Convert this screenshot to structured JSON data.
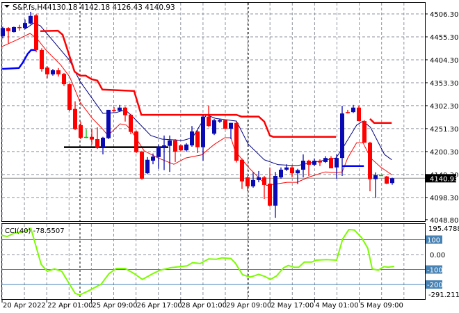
{
  "header": {
    "symbol": "S&P.fs,H4",
    "ohlc": "4130.18 4142.18 4126.43 4140.93"
  },
  "colors": {
    "bull": "#0a0ab4",
    "bear": "#ff0000",
    "ma_slow": "#000080",
    "ma_fast": "#ff0000",
    "stop_line": "#ff0000",
    "blue_line": "#0000ff",
    "cci": "#7cfc00",
    "level": "#4682b4",
    "grid": "#8c929c"
  },
  "price_axis": [
    "4506.30",
    "4455.30",
    "4404.30",
    "4353.30",
    "4302.30",
    "4251.30",
    "4200.30",
    "4149.30",
    "4098.30",
    "4048.80"
  ],
  "current_price": "4140.93",
  "time_axis": [
    "20 Apr 2022",
    "22 Apr 01:00",
    "25 Apr 09:00",
    "26 Apr 17:00",
    "28 Apr 01:00",
    "29 Apr 09:00",
    "2 May 17:00",
    "4 May 01:00",
    "5 May 09:00"
  ],
  "cci": {
    "label": "CCI(40) -78.5507",
    "max_label": "195.4788",
    "min_label": "-291.2113",
    "zero_label": "0.00",
    "levels": [
      "100",
      "-100",
      "-200"
    ]
  },
  "chart_data": {
    "type": "candlestick",
    "title": "S&P.fs,H4",
    "ylim": [
      4048.8,
      4506.3
    ],
    "candles": [
      [
        4457,
        4478,
        4452,
        4475
      ],
      [
        4475,
        4477,
        4441,
        4468
      ],
      [
        4466,
        4478,
        4465,
        4477
      ],
      [
        4477,
        4482,
        4469,
        4475
      ],
      [
        4475,
        4494,
        4472,
        4486
      ],
      [
        4485,
        4511,
        4483,
        4502
      ],
      [
        4503,
        4506,
        4421,
        4426
      ],
      [
        4426,
        4430,
        4378,
        4384
      ],
      [
        4387,
        4390,
        4363,
        4372
      ],
      [
        4372,
        4384,
        4369,
        4381
      ],
      [
        4381,
        4386,
        4367,
        4372
      ],
      [
        4373,
        4375,
        4346,
        4350
      ],
      [
        4350,
        4352,
        4290,
        4293
      ],
      [
        4295,
        4312,
        4248,
        4250
      ],
      [
        4259,
        4267,
        4228,
        4231
      ],
      [
        4233,
        4250,
        4230,
        4233
      ],
      [
        4233,
        4251,
        4216,
        4227
      ],
      [
        4228,
        4254,
        4206,
        4208
      ],
      [
        4210,
        4233,
        4194,
        4231
      ],
      [
        4230,
        4293,
        4228,
        4293
      ],
      [
        4293,
        4299,
        4289,
        4291
      ],
      [
        4291,
        4304,
        4289,
        4298
      ],
      [
        4298,
        4300,
        4267,
        4281
      ],
      [
        4282,
        4284,
        4239,
        4244
      ],
      [
        4245,
        4247,
        4197,
        4199
      ],
      [
        4200,
        4202,
        4138,
        4140
      ],
      [
        4152,
        4188,
        4150,
        4182
      ],
      [
        4180,
        4196,
        4172,
        4189
      ],
      [
        4188,
        4216,
        4162,
        4211
      ],
      [
        4210,
        4236,
        4159,
        4214
      ],
      [
        4213,
        4236,
        4155,
        4225
      ],
      [
        4225,
        4228,
        4177,
        4200
      ],
      [
        4214,
        4216,
        4200,
        4203
      ],
      [
        4203,
        4219,
        4200,
        4216
      ],
      [
        4214,
        4257,
        4211,
        4245
      ],
      [
        4245,
        4248,
        4197,
        4210
      ],
      [
        4210,
        4281,
        4180,
        4278
      ],
      [
        4278,
        4302,
        4255,
        4257
      ],
      [
        4240,
        4273,
        4237,
        4270
      ],
      [
        4267,
        4272,
        4264,
        4270
      ],
      [
        4270,
        4272,
        4250,
        4251
      ],
      [
        4251,
        4264,
        4228,
        4264
      ],
      [
        4264,
        4266,
        4176,
        4180
      ],
      [
        4182,
        4185,
        4117,
        4134
      ],
      [
        4143,
        4146,
        4112,
        4123
      ],
      [
        4123,
        4154,
        4120,
        4137
      ],
      [
        4137,
        4157,
        4132,
        4143
      ],
      [
        4143,
        4146,
        4095,
        4126
      ],
      [
        4129,
        4165,
        4078,
        4080
      ],
      [
        4080,
        4155,
        4053,
        4146
      ],
      [
        4143,
        4165,
        4140,
        4160
      ],
      [
        4160,
        4172,
        4157,
        4165
      ],
      [
        4165,
        4168,
        4143,
        4152
      ],
      [
        4152,
        4162,
        4128,
        4159
      ],
      [
        4160,
        4194,
        4143,
        4180
      ],
      [
        4180,
        4182,
        4146,
        4171
      ],
      [
        4171,
        4185,
        4168,
        4180
      ],
      [
        4180,
        4183,
        4168,
        4176
      ],
      [
        4177,
        4190,
        4175,
        4186
      ],
      [
        4186,
        4190,
        4163,
        4163
      ],
      [
        4165,
        4194,
        4140,
        4186
      ],
      [
        4186,
        4302,
        4146,
        4285
      ],
      [
        4288,
        4293,
        4285,
        4286
      ],
      [
        4288,
        4304,
        4286,
        4298
      ],
      [
        4298,
        4302,
        4268,
        4268
      ],
      [
        4268,
        4270,
        4220,
        4220
      ],
      [
        4220,
        4222,
        4112,
        4139
      ],
      [
        4139,
        4154,
        4097,
        4148
      ],
      [
        4148,
        4149,
        4147,
        4148
      ],
      [
        4145,
        4146,
        4128,
        4129
      ],
      [
        4130.18,
        4142.18,
        4126.43,
        4140.93
      ]
    ],
    "ma_slow": [
      [
        3.9,
        4472
      ],
      [
        5.6,
        4486
      ],
      [
        6.75,
        4480
      ],
      [
        12,
        4403
      ],
      [
        13.9,
        4356
      ],
      [
        18,
        4285
      ],
      [
        20.4,
        4287
      ],
      [
        22,
        4293
      ],
      [
        23.25,
        4279
      ],
      [
        26.6,
        4236
      ],
      [
        28.6,
        4228
      ],
      [
        32.4,
        4225
      ],
      [
        34.1,
        4231
      ],
      [
        36.6,
        4282
      ],
      [
        38.25,
        4274
      ],
      [
        42,
        4268
      ],
      [
        44.1,
        4217
      ],
      [
        47,
        4182
      ],
      [
        49.5,
        4171
      ],
      [
        52.9,
        4169
      ],
      [
        54.9,
        4174
      ],
      [
        59.9,
        4186
      ],
      [
        61.1,
        4208
      ],
      [
        63.6,
        4259
      ],
      [
        64.75,
        4268
      ],
      [
        66.1,
        4254
      ],
      [
        68.6,
        4194
      ],
      [
        69.9,
        4182
      ]
    ],
    "ma_fast": [
      [
        -0.1,
        4434
      ],
      [
        2.6,
        4449
      ],
      [
        4.9,
        4463
      ],
      [
        6.1,
        4452
      ],
      [
        7.9,
        4424
      ],
      [
        10.4,
        4393
      ],
      [
        12,
        4367
      ],
      [
        13.9,
        4310
      ],
      [
        16.1,
        4274
      ],
      [
        17.9,
        4251
      ],
      [
        18.9,
        4236
      ],
      [
        21.1,
        4262
      ],
      [
        22.25,
        4259
      ],
      [
        23.25,
        4244
      ],
      [
        25.4,
        4202
      ],
      [
        27.9,
        4186
      ],
      [
        30.75,
        4172
      ],
      [
        32.9,
        4186
      ],
      [
        35.75,
        4193
      ],
      [
        38,
        4216
      ],
      [
        39.9,
        4231
      ],
      [
        41,
        4231
      ],
      [
        41.75,
        4202
      ],
      [
        44.1,
        4166
      ],
      [
        47.4,
        4125
      ],
      [
        51.1,
        4132
      ],
      [
        52.9,
        4132
      ],
      [
        54.9,
        4143
      ],
      [
        57.9,
        4155
      ],
      [
        59.9,
        4154
      ],
      [
        61,
        4155
      ],
      [
        62,
        4186
      ],
      [
        63.6,
        4220
      ],
      [
        64.75,
        4220
      ],
      [
        66.1,
        4186
      ],
      [
        67.9,
        4166
      ],
      [
        69.9,
        4149
      ]
    ],
    "stop_line": [
      [
        [
          6.75,
          4468
        ],
        [
          9.9,
          4469
        ],
        [
          10.75,
          4460
        ],
        [
          12.9,
          4378
        ],
        [
          13.9,
          4369
        ],
        [
          14.9,
          4369
        ],
        [
          16,
          4361
        ],
        [
          17,
          4358
        ],
        [
          17.9,
          4338
        ],
        [
          23.6,
          4335
        ],
        [
          24.9,
          4282
        ],
        [
          42,
          4282
        ],
        [
          42.9,
          4278
        ],
        [
          46,
          4278
        ],
        [
          47,
          4267
        ],
        [
          48,
          4236
        ],
        [
          48.6,
          4233
        ],
        [
          59.9,
          4233
        ]
      ],
      [
        [
          66,
          4273
        ],
        [
          66.75,
          4264
        ],
        [
          69.9,
          4264
        ]
      ]
    ],
    "blue_line": [
      [
        [
          -0.1,
          4384
        ],
        [
          2.9,
          4386
        ],
        [
          3.6,
          4398
        ],
        [
          4.5,
          4418
        ],
        [
          5.1,
          4426
        ],
        [
          6,
          4426
        ]
      ],
      [
        [
          61,
          4168
        ],
        [
          64.9,
          4168
        ]
      ]
    ],
    "support_line": {
      "from": 11,
      "to": 29.75,
      "price": 4210
    },
    "cci_series": [
      [
        -0.24,
        129
      ],
      [
        0.8,
        121
      ],
      [
        2.1,
        144
      ],
      [
        3.7,
        152
      ],
      [
        5.05,
        175
      ],
      [
        6.9,
        -65
      ],
      [
        8,
        -112
      ],
      [
        9.3,
        -96
      ],
      [
        10.6,
        -112
      ],
      [
        13,
        -259
      ],
      [
        13.8,
        -270
      ],
      [
        15.4,
        -243
      ],
      [
        17.7,
        -197
      ],
      [
        19.1,
        -127
      ],
      [
        20.4,
        -93
      ],
      [
        22,
        -93
      ],
      [
        23.6,
        -127
      ],
      [
        25.1,
        -166
      ],
      [
        27,
        -127
      ],
      [
        28.3,
        -104
      ],
      [
        30.2,
        -88
      ],
      [
        31.8,
        -81
      ],
      [
        33.1,
        -76
      ],
      [
        34.1,
        -54
      ],
      [
        35.5,
        -60
      ],
      [
        37,
        -29
      ],
      [
        38.4,
        -31
      ],
      [
        39.4,
        -22
      ],
      [
        41,
        -26
      ],
      [
        41.8,
        -57
      ],
      [
        43.1,
        -135
      ],
      [
        44.5,
        -150
      ],
      [
        46,
        -132
      ],
      [
        47.1,
        -146
      ],
      [
        48.1,
        -166
      ],
      [
        49.2,
        -143
      ],
      [
        50.5,
        -88
      ],
      [
        51.3,
        -73
      ],
      [
        52.4,
        -85
      ],
      [
        53.2,
        -84
      ],
      [
        54.2,
        -50
      ],
      [
        55.55,
        -50
      ],
      [
        56.3,
        -37
      ],
      [
        58.2,
        -34
      ],
      [
        60,
        -37
      ],
      [
        61.1,
        105
      ],
      [
        62.2,
        167
      ],
      [
        63.2,
        164
      ],
      [
        64.5,
        113
      ],
      [
        65.6,
        43
      ],
      [
        66.4,
        -96
      ],
      [
        67.5,
        -104
      ],
      [
        68.5,
        -81
      ],
      [
        69.3,
        -84
      ],
      [
        70.35,
        -78.55
      ]
    ],
    "cci_range": [
      -291.2113,
      195.4788
    ]
  }
}
